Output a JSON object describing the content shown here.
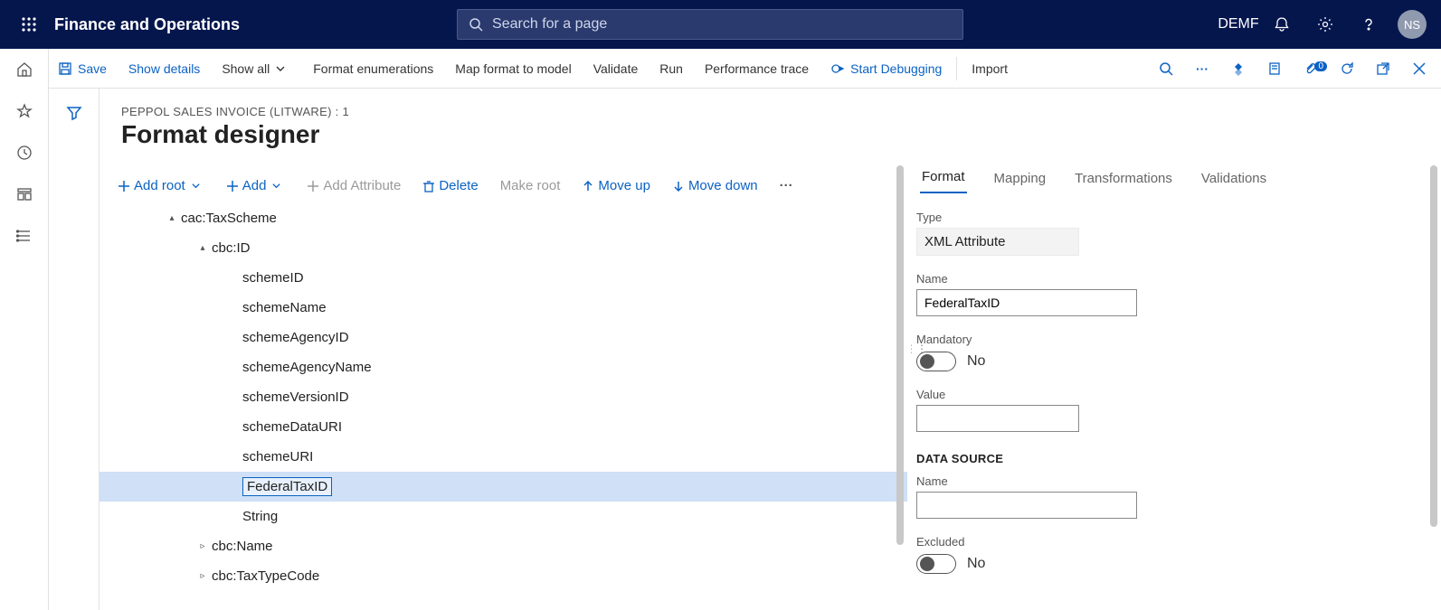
{
  "topbar": {
    "title": "Finance and Operations",
    "search_placeholder": "Search for a page",
    "company": "DEMF",
    "avatar_initials": "NS"
  },
  "actionbar": {
    "save": "Save",
    "show_details": "Show details",
    "show_all": "Show all",
    "format_enum": "Format enumerations",
    "map_format": "Map format to model",
    "validate": "Validate",
    "run": "Run",
    "perf_trace": "Performance trace",
    "start_debug": "Start Debugging",
    "import": "Import",
    "attach_badge": "0"
  },
  "page": {
    "breadcrumb": "PEPPOL SALES INVOICE (LITWARE) : 1",
    "title": "Format designer"
  },
  "treetoolbar": {
    "add_root": "Add root",
    "add": "Add",
    "add_attr": "Add Attribute",
    "delete": "Delete",
    "make_root": "Make root",
    "move_up": "Move up",
    "move_down": "Move down"
  },
  "tree": {
    "n0": "cac:TaxScheme",
    "n1": "cbc:ID",
    "c": {
      "0": "schemeID",
      "1": "schemeName",
      "2": "schemeAgencyID",
      "3": "schemeAgencyName",
      "4": "schemeVersionID",
      "5": "schemeDataURI",
      "6": "schemeURI",
      "7": "FederalTaxID",
      "8": "String"
    },
    "n2": "cbc:Name",
    "n3": "cbc:TaxTypeCode"
  },
  "tabs": {
    "format": "Format",
    "mapping": "Mapping",
    "transformations": "Transformations",
    "validations": "Validations"
  },
  "props": {
    "type_label": "Type",
    "type_value": "XML Attribute",
    "name_label": "Name",
    "name_value": "FederalTaxID",
    "mandatory_label": "Mandatory",
    "mandatory_value": "No",
    "value_label": "Value",
    "value_value": "",
    "ds_section": "DATA SOURCE",
    "ds_name_label": "Name",
    "ds_name_value": "",
    "excluded_label": "Excluded",
    "excluded_value": "No"
  }
}
